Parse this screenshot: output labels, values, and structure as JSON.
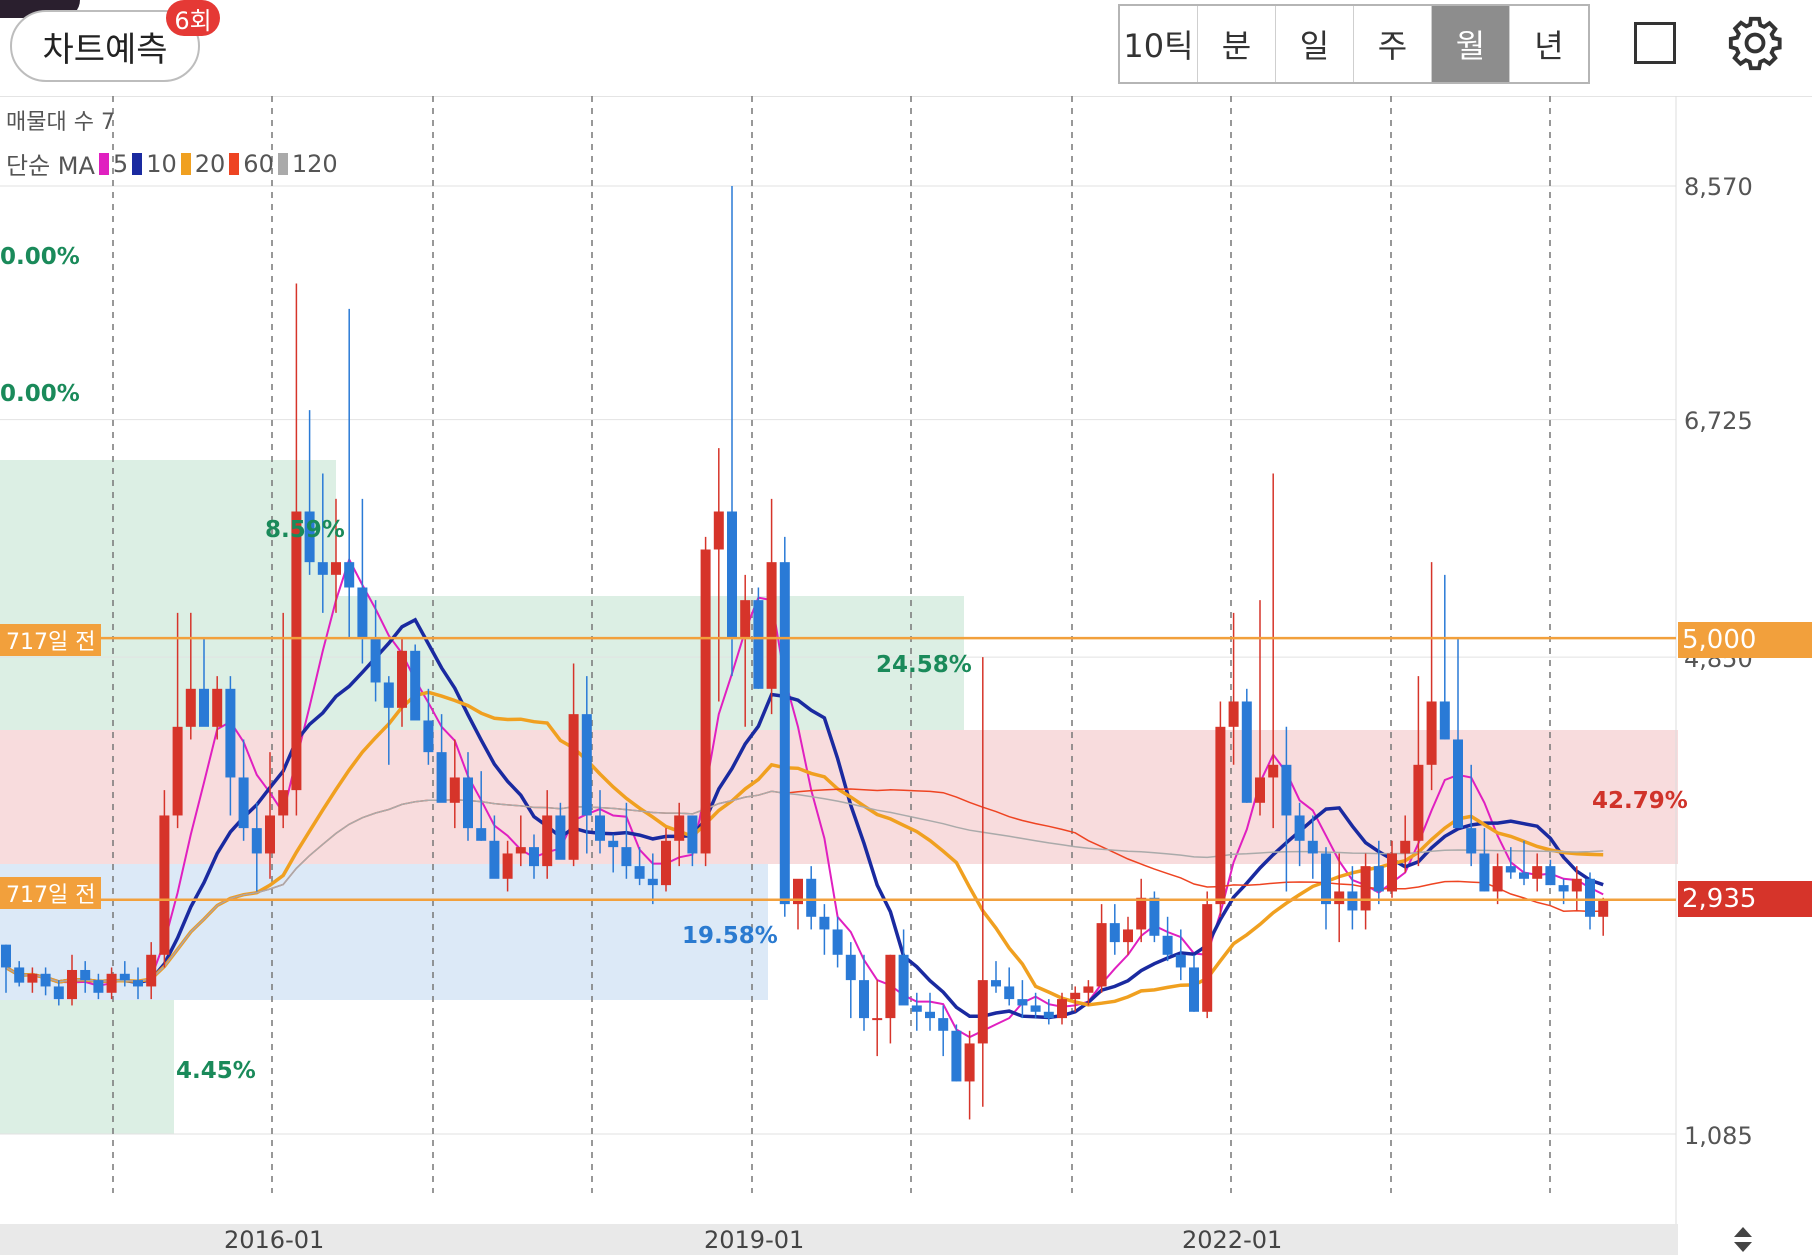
{
  "toolbar": {
    "predict_label": "차트예측",
    "predict_badge": "6회",
    "periods": [
      "10틱",
      "분",
      "일",
      "주",
      "월",
      "년"
    ],
    "active_period": "월"
  },
  "legend": {
    "volume_profile": "매물대 수 7",
    "ma_title": "단순 MA",
    "ma_items": [
      {
        "label": "5",
        "color": "#e020c0"
      },
      {
        "label": "10",
        "color": "#1a2aa0"
      },
      {
        "label": "20",
        "color": "#f0a020"
      },
      {
        "label": "60",
        "color": "#ee4422"
      },
      {
        "label": "120",
        "color": "#aaaaaa"
      }
    ]
  },
  "y_axis": [
    "8,570",
    "6,725",
    "4,850",
    "1,085"
  ],
  "x_axis": [
    "2016-01",
    "2019-01",
    "2022-01"
  ],
  "price_tags": {
    "upper": "5,000",
    "current": "2,935"
  },
  "horizontal_lines": {
    "upper_label": "717일 전",
    "lower_label": "717일 전"
  },
  "percent_labels": [
    {
      "text": "0.00%",
      "color": "#1a8a5a"
    },
    {
      "text": "0.00%",
      "color": "#1a8a5a"
    },
    {
      "text": "8.59%",
      "color": "#1a8a5a"
    },
    {
      "text": "24.58%",
      "color": "#1a8a5a"
    },
    {
      "text": "19.58%",
      "color": "#2a7ad0"
    },
    {
      "text": "4.45%",
      "color": "#1a8a5a"
    },
    {
      "text": "42.79%",
      "color": "#d0332a"
    }
  ],
  "colors": {
    "up_candle": "#d6342a",
    "down_candle": "#2a7ad6",
    "orange_line": "#f2a03c",
    "current_price_bg": "#d6342a"
  },
  "chart_data": {
    "type": "candlestick",
    "ylim": [
      1085,
      8570
    ],
    "start": "2014-05",
    "interval": "month",
    "ohlc": [
      [
        2580,
        2580,
        2200,
        2400
      ],
      [
        2400,
        2450,
        2250,
        2280
      ],
      [
        2280,
        2400,
        2200,
        2350
      ],
      [
        2350,
        2400,
        2180,
        2250
      ],
      [
        2250,
        2300,
        2100,
        2150
      ],
      [
        2150,
        2500,
        2100,
        2380
      ],
      [
        2380,
        2450,
        2200,
        2300
      ],
      [
        2300,
        2350,
        2150,
        2200
      ],
      [
        2200,
        2400,
        2150,
        2350
      ],
      [
        2350,
        2450,
        2250,
        2300
      ],
      [
        2300,
        2400,
        2150,
        2250
      ],
      [
        2250,
        2600,
        2150,
        2500
      ],
      [
        2500,
        3800,
        2400,
        3600
      ],
      [
        3600,
        5200,
        3500,
        4300
      ],
      [
        4300,
        5200,
        4200,
        4600
      ],
      [
        4600,
        5000,
        4400,
        4300
      ],
      [
        4300,
        4700,
        4200,
        4600
      ],
      [
        4600,
        4700,
        3600,
        3900
      ],
      [
        3900,
        4200,
        3400,
        3500
      ],
      [
        3500,
        3700,
        3000,
        3300
      ],
      [
        3300,
        4100,
        3100,
        3600
      ],
      [
        3600,
        5200,
        3500,
        3800
      ],
      [
        3800,
        7800,
        3600,
        6000
      ],
      [
        6000,
        6800,
        5500,
        5600
      ],
      [
        5600,
        6300,
        5200,
        5500
      ],
      [
        5500,
        6100,
        5200,
        5600
      ],
      [
        5600,
        7600,
        5000,
        5400
      ],
      [
        5400,
        6100,
        4800,
        5000
      ],
      [
        5000,
        5300,
        4500,
        4650
      ],
      [
        4650,
        4700,
        4000,
        4450
      ],
      [
        4450,
        5000,
        4300,
        4900
      ],
      [
        4900,
        4950,
        4500,
        4350
      ],
      [
        4350,
        4600,
        4000,
        4100
      ],
      [
        4100,
        4400,
        3800,
        3700
      ],
      [
        3700,
        4200,
        3500,
        3900
      ],
      [
        3900,
        4100,
        3400,
        3500
      ],
      [
        3500,
        3950,
        3400,
        3400
      ],
      [
        3400,
        3600,
        3200,
        3100
      ],
      [
        3100,
        3400,
        3000,
        3300
      ],
      [
        3300,
        3600,
        3200,
        3350
      ],
      [
        3350,
        3450,
        3100,
        3200
      ],
      [
        3200,
        3800,
        3100,
        3600
      ],
      [
        3600,
        3700,
        3300,
        3250
      ],
      [
        3250,
        4800,
        3200,
        4400
      ],
      [
        4400,
        4700,
        3300,
        3600
      ],
      [
        3600,
        3800,
        3300,
        3400
      ],
      [
        3400,
        3450,
        3150,
        3350
      ],
      [
        3350,
        3700,
        3100,
        3200
      ],
      [
        3200,
        3350,
        3050,
        3100
      ],
      [
        3100,
        3300,
        2900,
        3050
      ],
      [
        3050,
        3500,
        3000,
        3400
      ],
      [
        3400,
        3700,
        3200,
        3600
      ],
      [
        3600,
        3600,
        3200,
        3300
      ],
      [
        3300,
        5800,
        3200,
        5700
      ],
      [
        5700,
        6500,
        4500,
        6000
      ],
      [
        6000,
        8570,
        4700,
        5000
      ],
      [
        5000,
        5500,
        4300,
        5300
      ],
      [
        5300,
        5400,
        4600,
        4600
      ],
      [
        4600,
        6100,
        4400,
        5600
      ],
      [
        5600,
        5800,
        2800,
        2900
      ],
      [
        2900,
        3000,
        2700,
        3100
      ],
      [
        3100,
        3200,
        2700,
        2800
      ],
      [
        2800,
        2900,
        2500,
        2700
      ],
      [
        2700,
        2800,
        2400,
        2500
      ],
      [
        2500,
        2600,
        2000,
        2300
      ],
      [
        2300,
        2500,
        1900,
        2000
      ],
      [
        2000,
        2300,
        1700,
        2000
      ],
      [
        2000,
        2500,
        1800,
        2500
      ],
      [
        2500,
        2700,
        2200,
        2100
      ],
      [
        2100,
        2200,
        1900,
        2050
      ],
      [
        2050,
        2200,
        1900,
        2000
      ],
      [
        2000,
        2100,
        1700,
        1900
      ],
      [
        1900,
        1950,
        1500,
        1500
      ],
      [
        1500,
        1900,
        1200,
        1800
      ],
      [
        1800,
        4850,
        1300,
        2300
      ],
      [
        2300,
        2450,
        2200,
        2250
      ],
      [
        2250,
        2400,
        2100,
        2150
      ],
      [
        2150,
        2300,
        2000,
        2100
      ],
      [
        2100,
        2200,
        2000,
        2050
      ],
      [
        2050,
        2150,
        1950,
        2000
      ],
      [
        2000,
        2200,
        1950,
        2150
      ],
      [
        2150,
        2250,
        2050,
        2200
      ],
      [
        2200,
        2300,
        2100,
        2250
      ],
      [
        2250,
        2900,
        2200,
        2750
      ],
      [
        2750,
        2900,
        2500,
        2600
      ],
      [
        2600,
        2800,
        2500,
        2700
      ],
      [
        2700,
        3100,
        2600,
        2950
      ],
      [
        2950,
        3000,
        2600,
        2650
      ],
      [
        2650,
        2800,
        2450,
        2500
      ],
      [
        2500,
        2700,
        2300,
        2400
      ],
      [
        2400,
        2500,
        2050,
        2050
      ],
      [
        2050,
        3000,
        2000,
        2900
      ],
      [
        2900,
        4500,
        2800,
        4300
      ],
      [
        4300,
        5200,
        4000,
        4500
      ],
      [
        4500,
        4600,
        3700,
        3700
      ],
      [
        3700,
        5300,
        3600,
        3900
      ],
      [
        3900,
        6300,
        3500,
        4000
      ],
      [
        4000,
        4300,
        3000,
        3600
      ],
      [
        3600,
        3700,
        3200,
        3400
      ],
      [
        3400,
        3600,
        3100,
        3300
      ],
      [
        3300,
        3350,
        2700,
        2900
      ],
      [
        2900,
        3300,
        2600,
        3000
      ],
      [
        3000,
        3200,
        2700,
        2850
      ],
      [
        2850,
        3300,
        2700,
        3200
      ],
      [
        3200,
        3400,
        2900,
        3000
      ],
      [
        3000,
        3400,
        2950,
        3300
      ],
      [
        3300,
        3600,
        3150,
        3400
      ],
      [
        3400,
        4700,
        3200,
        4000
      ],
      [
        4000,
        5600,
        3800,
        4500
      ],
      [
        4500,
        5500,
        4200,
        4200
      ],
      [
        4200,
        5000,
        3700,
        3500
      ],
      [
        3500,
        4000,
        3200,
        3300
      ],
      [
        3300,
        3500,
        3000,
        3000
      ],
      [
        3000,
        3300,
        2900,
        3200
      ],
      [
        3200,
        3350,
        3100,
        3150
      ],
      [
        3150,
        3400,
        3050,
        3100
      ],
      [
        3100,
        3300,
        3000,
        3200
      ],
      [
        3200,
        3250,
        3050,
        3050
      ],
      [
        3050,
        3100,
        2900,
        3000
      ],
      [
        3000,
        3200,
        2850,
        3100
      ],
      [
        3100,
        3150,
        2700,
        2800
      ],
      [
        2800,
        2950,
        2650,
        2935
      ]
    ],
    "moving_averages": [
      {
        "period": 5,
        "color": "#e020c0"
      },
      {
        "period": 10,
        "color": "#1a2aa0"
      },
      {
        "period": 20,
        "color": "#f0a020"
      },
      {
        "period": 60,
        "color": "#ee4422"
      },
      {
        "period": 120,
        "color": "#aaaaaa"
      }
    ],
    "horizontal_lines": [
      5000,
      2935
    ]
  }
}
